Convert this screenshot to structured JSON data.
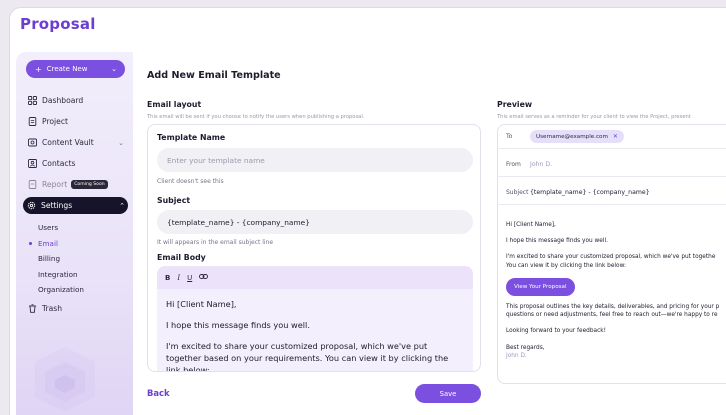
{
  "app": {
    "logo": "Proposal"
  },
  "sidebar": {
    "create_label": "Create New",
    "items": [
      {
        "label": "Dashboard",
        "icon": "grid-icon"
      },
      {
        "label": "Project",
        "icon": "file-icon"
      },
      {
        "label": "Content Vault",
        "icon": "vault-icon"
      },
      {
        "label": "Contacts",
        "icon": "contacts-icon"
      },
      {
        "label": "Report",
        "icon": "report-icon",
        "badge": "Coming Soon"
      },
      {
        "label": "Settings",
        "icon": "gear-icon"
      },
      {
        "label": "Trash",
        "icon": "trash-icon"
      }
    ],
    "settings_sub": [
      "Users",
      "Email",
      "Billing",
      "Integration",
      "Organization"
    ]
  },
  "page": {
    "title": "Add New Email Template"
  },
  "layout": {
    "heading": "Email layout",
    "description": "This email will be sent if you choose to notify the users when publishing a proposal."
  },
  "form": {
    "template_name_label": "Template Name",
    "template_name_placeholder": "Enter your template name",
    "template_name_hint": "Client doesn't see this",
    "subject_label": "Subject",
    "subject_value": "{template_name} - {company_name}",
    "subject_hint": "It will appears in the email subject line",
    "body_label": "Email Body",
    "toolbar": [
      "B",
      "I",
      "U",
      "link"
    ],
    "body_paragraphs": [
      "Hi [Client Name],",
      "I hope this message finds you well.",
      "I'm excited to share your customized proposal, which we've put together based on your requirements. You can view it by clicking the link below:"
    ]
  },
  "actions": {
    "back": "Back",
    "save": "Save"
  },
  "preview": {
    "heading": "Preview",
    "description": "This email serves as a reminder for your client to view the Project, present",
    "to_label": "To",
    "to_chip": "Username@example.com",
    "from_label": "From",
    "from_value": "John D.",
    "subject_label": "Subject",
    "subject_value": "{template_name} - {company_name}",
    "greeting": "Hi [Client Name],",
    "line1": "I hope this message finds you well.",
    "line2a": "I'm excited to share your customized proposal, which we've put togethe",
    "line2b": "You can view it by clicking the link below:",
    "button": "View Your Proposal",
    "line3a": "This proposal outlines the key details, deliverables, and pricing for your p",
    "line3b": "questions or need adjustments, feel free to reach out—we're happy to re",
    "line4": "Looking forward to your feedback!",
    "regards": "Best regards,",
    "signature": "John D."
  },
  "colors": {
    "accent": "#7b4fe0",
    "active_nav": "#16142a"
  }
}
